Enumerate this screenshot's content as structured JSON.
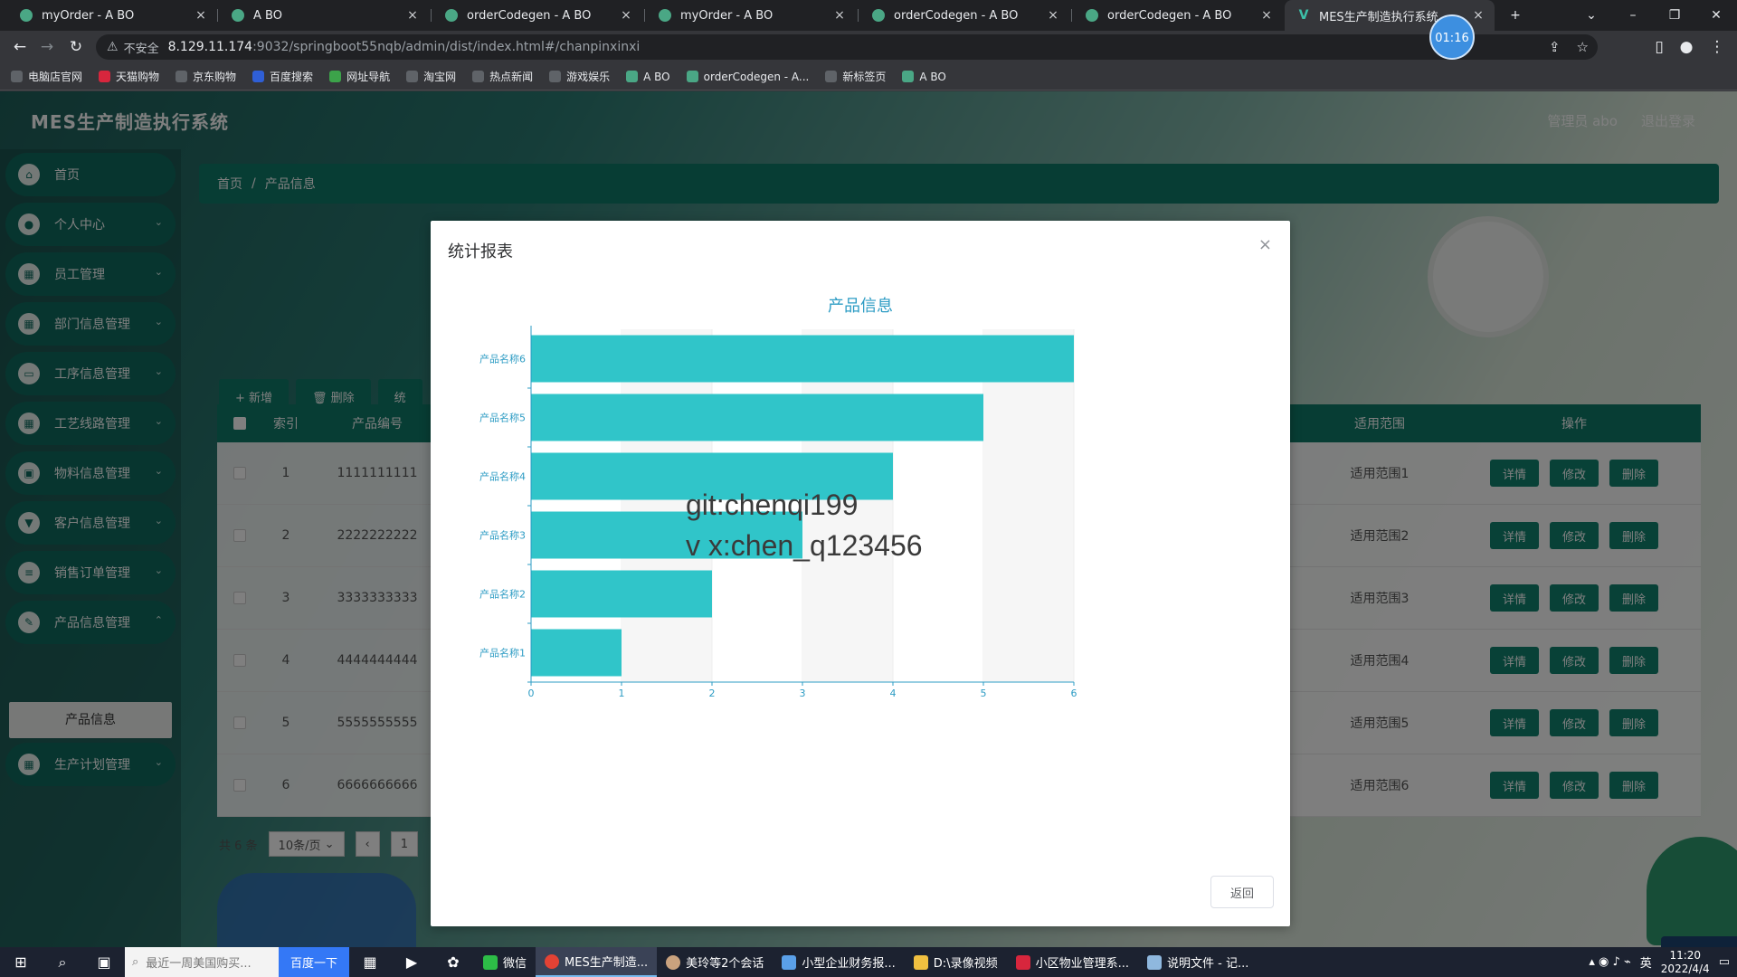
{
  "browser": {
    "tabs": [
      {
        "title": "myOrder - A BO"
      },
      {
        "title": "A BO"
      },
      {
        "title": "orderCodegen - A BO"
      },
      {
        "title": "myOrder - A BO"
      },
      {
        "title": "orderCodegen - A BO"
      },
      {
        "title": "orderCodegen - A BO"
      },
      {
        "title": "MES生产制造执行系统"
      }
    ],
    "timer": "01:16",
    "address": {
      "insecure_label": "不安全",
      "host": "8.129.11.174",
      "path": ":9032/springboot55nqb/admin/dist/index.html#/chanpinxinxi"
    },
    "bookmarks": [
      "电脑店官网",
      "天猫购物",
      "京东购物",
      "百度搜索",
      "网址导航",
      "淘宝网",
      "热点新闻",
      "游戏娱乐",
      "A BO",
      "orderCodegen - A...",
      "新标签页",
      "A BO"
    ]
  },
  "app": {
    "title": "MES生产制造执行系统",
    "user_label": "管理员 abo",
    "logout_label": "退出登录"
  },
  "sidebar": {
    "items": [
      {
        "label": "首页",
        "icon": "home-icon"
      },
      {
        "label": "个人中心",
        "icon": "user-icon"
      },
      {
        "label": "员工管理",
        "icon": "grid-icon"
      },
      {
        "label": "部门信息管理",
        "icon": "grid-icon"
      },
      {
        "label": "工序信息管理",
        "icon": "monitor-icon"
      },
      {
        "label": "工艺线路管理",
        "icon": "grid-icon"
      },
      {
        "label": "物料信息管理",
        "icon": "box-icon"
      },
      {
        "label": "客户信息管理",
        "icon": "cup-icon"
      },
      {
        "label": "销售订单管理",
        "icon": "list-icon"
      },
      {
        "label": "产品信息管理",
        "icon": "edit-icon"
      },
      {
        "label": "生产计划管理",
        "icon": "grid-icon"
      }
    ],
    "submenu_active": "产品信息"
  },
  "breadcrumb": {
    "home": "首页",
    "sep": "/",
    "current": "产品信息"
  },
  "toolbar": {
    "add": "+ 新增",
    "delete": "🗑 删除",
    "stats": "统"
  },
  "table": {
    "headers": {
      "index": "索引",
      "code": "产品编号",
      "scope": "适用范围",
      "ops": "操作"
    },
    "rows": [
      {
        "index": "1",
        "code": "1111111111",
        "scope": "适用范围1"
      },
      {
        "index": "2",
        "code": "2222222222",
        "scope": "适用范围2"
      },
      {
        "index": "3",
        "code": "3333333333",
        "scope": "适用范围3"
      },
      {
        "index": "4",
        "code": "4444444444",
        "scope": "适用范围4"
      },
      {
        "index": "5",
        "code": "5555555555",
        "scope": "适用范围5"
      },
      {
        "index": "6",
        "code": "6666666666",
        "scope": "适用范围6"
      }
    ],
    "ops": {
      "detail": "详情",
      "edit": "修改",
      "delete": "删除"
    }
  },
  "pager": {
    "total": "共 6 条",
    "page_size": "10条/页",
    "page": "1"
  },
  "modal": {
    "title": "统计报表",
    "close": "×",
    "back_label": "返回",
    "watermark_line1": "git:chenqi199",
    "watermark_line2": "v x:chen_q123456"
  },
  "chart_data": {
    "type": "bar",
    "orientation": "horizontal",
    "title": "产品信息",
    "categories": [
      "产品名称1",
      "产品名称2",
      "产品名称3",
      "产品名称4",
      "产品名称5",
      "产品名称6"
    ],
    "values": [
      1,
      2,
      3,
      4,
      5,
      6
    ],
    "xlim": [
      0,
      6
    ],
    "xticks": [
      "0",
      "1",
      "2",
      "3",
      "4",
      "5",
      "6"
    ],
    "bar_color": "#30c5c9",
    "axis_color": "#2d9cc4",
    "grid": true
  },
  "taskbar": {
    "search_placeholder": "最近一周美国购买...",
    "baidu_label": "百度一下",
    "apps": [
      "微信",
      "MES生产制造...",
      "美玲等2个会话",
      "小型企业财务报...",
      "D:\\录像视频",
      "小区物业管理系...",
      "说明文件 - 记..."
    ],
    "ime": "英",
    "time": "11:20",
    "date": "2022/4/4"
  }
}
